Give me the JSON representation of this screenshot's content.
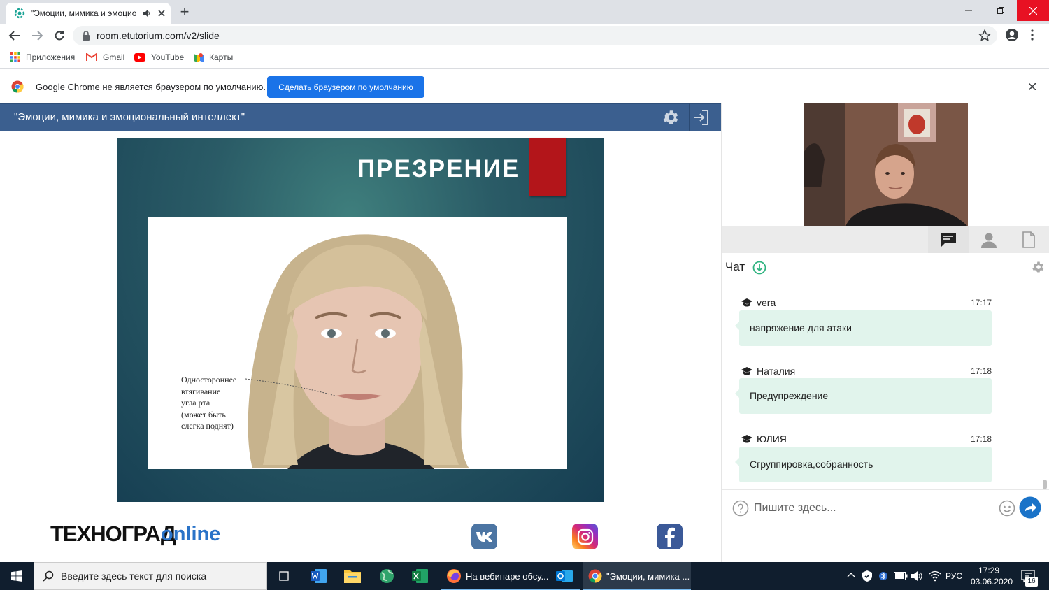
{
  "browser": {
    "tab_title": "\"Эмоции, мимика и эмоцио",
    "url": "room.etutorium.com/v2/slide",
    "bookmarks": [
      {
        "label": "Приложения",
        "icon": "apps-grid-icon"
      },
      {
        "label": "Gmail",
        "icon": "gmail-icon"
      },
      {
        "label": "YouTube",
        "icon": "youtube-icon"
      },
      {
        "label": "Карты",
        "icon": "maps-icon"
      }
    ],
    "infobar": {
      "message": "Google Chrome не является браузером по умолчанию.",
      "button": "Сделать браузером по умолчанию"
    }
  },
  "room": {
    "title": "\"Эмоции, мимика и эмоциональный интеллект\""
  },
  "slide": {
    "title": "ПРЕЗРЕНИЕ",
    "caption": "Одностороннее\nвтягивание\nугла рта\n(может быть\nслегка поднят)",
    "accent_color": "#b3151a"
  },
  "branding": {
    "logo_main": "ТЕХНОГРАД",
    "logo_suffix": "online",
    "socials": [
      "vk-icon",
      "instagram-icon",
      "facebook-icon"
    ]
  },
  "chat": {
    "title": "Чат",
    "messages": [
      {
        "author": "vera",
        "time": "17:17",
        "text": "напряжение для атаки"
      },
      {
        "author": "Наталия",
        "time": "17:18",
        "text": "Предупреждение"
      },
      {
        "author": "ЮЛИЯ",
        "time": "17:18",
        "text": "Сгруппировка,собранность"
      }
    ],
    "input_placeholder": "Пишите здесь..."
  },
  "taskbar": {
    "search_placeholder": "Введите здесь текст для поиска",
    "apps": [
      {
        "label": "На вебинаре обсу...",
        "icon": "firefox-icon"
      },
      {
        "label": "\"Эмоции, мимика ...",
        "icon": "chrome-icon"
      }
    ],
    "tray": {
      "language": "РУС",
      "time": "17:29",
      "date": "03.06.2020",
      "notifications": "16"
    }
  }
}
